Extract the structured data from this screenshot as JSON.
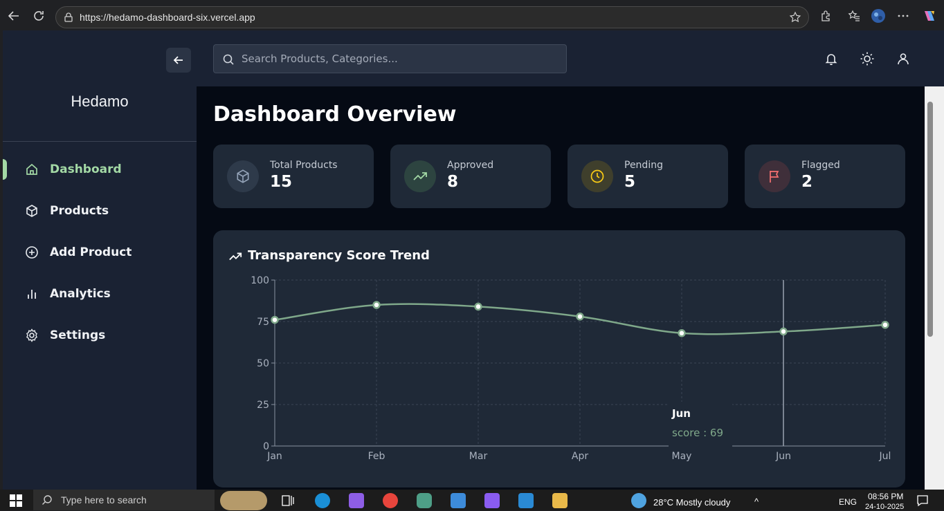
{
  "browser": {
    "url": "https://hedamo-dashboard-six.vercel.app"
  },
  "sidebar": {
    "brand": "Hedamo",
    "items": [
      {
        "label": "Dashboard",
        "icon": "home-icon",
        "active": true
      },
      {
        "label": "Products",
        "icon": "box-icon",
        "active": false
      },
      {
        "label": "Add Product",
        "icon": "plus-circle-icon",
        "active": false
      },
      {
        "label": "Analytics",
        "icon": "bar-chart-icon",
        "active": false
      },
      {
        "label": "Settings",
        "icon": "gear-icon",
        "active": false
      }
    ]
  },
  "topbar": {
    "search_placeholder": "Search Products, Categories..."
  },
  "main": {
    "title": "Dashboard Overview",
    "stats": [
      {
        "label": "Total Products",
        "value": "15",
        "icon": "box-icon",
        "color": "#94a3b8"
      },
      {
        "label": "Approved",
        "value": "8",
        "icon": "trend-up-icon",
        "color": "#a3d9a5"
      },
      {
        "label": "Pending",
        "value": "5",
        "icon": "clock-icon",
        "color": "#facc15"
      },
      {
        "label": "Flagged",
        "value": "2",
        "icon": "flag-icon",
        "color": "#f87171"
      }
    ],
    "chart_title": "Transparency Score Trend"
  },
  "chart_data": {
    "type": "line",
    "title": "Transparency Score Trend",
    "categories": [
      "Jan",
      "Feb",
      "Mar",
      "Apr",
      "May",
      "Jun",
      "Jul"
    ],
    "series": [
      {
        "values": [
          76,
          85,
          84,
          78,
          68,
          69,
          73
        ]
      }
    ],
    "ylim": [
      0,
      100
    ],
    "yticks": [
      0,
      25,
      50,
      75,
      100
    ],
    "grid": true,
    "line_color": "#7fa88a",
    "tooltip": {
      "category": "Jun",
      "label": "score : 69"
    }
  },
  "taskbar": {
    "search_placeholder": "Type here to search",
    "weather": "28°C  Mostly cloudy",
    "language": "ENG",
    "time": "08:56 PM",
    "date": "24-10-2025"
  }
}
